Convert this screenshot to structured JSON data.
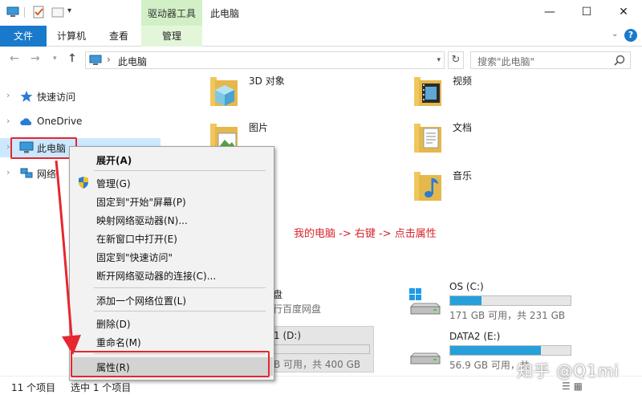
{
  "window": {
    "title": "此电脑",
    "contextual_tab_group": "驱动器工具",
    "controls": {
      "minimize": "—",
      "maximize": "☐",
      "close": "✕"
    }
  },
  "quick_access_toolbar": {
    "dropdown": "▾"
  },
  "ribbon": {
    "tabs": {
      "file": "文件",
      "computer": "计算机",
      "view": "查看",
      "manage": "管理"
    },
    "collapse_toggle": "⌄",
    "help": "?"
  },
  "address": {
    "back": "←",
    "forward": "→",
    "history": "▾",
    "up": "↑",
    "separator": "›",
    "path": "此电脑",
    "dropdown": "▾",
    "refresh": "↻",
    "search_placeholder": "搜索\"此电脑\""
  },
  "nav_pane": {
    "items": [
      {
        "label": "快速访问",
        "icon": "star-icon",
        "chevron": "›"
      },
      {
        "label": "OneDrive",
        "icon": "cloud-icon",
        "chevron": "›"
      },
      {
        "label": "此电脑",
        "icon": "computer-icon",
        "chevron": "›"
      },
      {
        "label": "网络",
        "icon": "network-icon",
        "chevron": "›"
      }
    ]
  },
  "folders": [
    {
      "label": "3D 对象",
      "icon": "3d-objects-folder-icon"
    },
    {
      "label": "视频",
      "icon": "videos-folder-icon"
    },
    {
      "label": "图片",
      "icon": "pictures-folder-icon"
    },
    {
      "label": "文档",
      "icon": "documents-folder-icon"
    },
    {
      "label": "音乐",
      "icon": "music-folder-icon"
    }
  ],
  "annotation": "我的电脑 -> 右键 -> 点击属性",
  "drives": [
    {
      "name": "OS (C:)",
      "info": "171 GB 可用，共 231 GB",
      "used_fraction": 0.26
    },
    {
      "name": "DATA2 (E:)",
      "info": "56.9 GB 可用，共 ",
      "used_fraction": 0.75
    }
  ],
  "partial_items": {
    "baidu_title": "盘",
    "baidu_sub": "行百度网盘",
    "d_drive_name": "1 (D:)",
    "d_drive_info": "B 可用，共 400 GB"
  },
  "context_menu": {
    "items": [
      {
        "label": "展开(A)"
      },
      {
        "label": "管理(G)"
      },
      {
        "label": "固定到\"开始\"屏幕(P)"
      },
      {
        "label": "映射网络驱动器(N)..."
      },
      {
        "label": "在新窗口中打开(E)"
      },
      {
        "label": "固定到\"快速访问\""
      },
      {
        "label": "断开网络驱动器的连接(C)..."
      },
      {
        "label": "添加一个网络位置(L)"
      },
      {
        "label": "删除(D)"
      },
      {
        "label": "重命名(M)"
      },
      {
        "label": "属性(R)"
      }
    ]
  },
  "status_bar": {
    "count": "11 个项目",
    "selected": "选中 1 个项目",
    "view_toggle": "☰ ▦"
  },
  "watermark": "知乎 @Q1mi",
  "colors": {
    "accent": "#1979ca",
    "selection": "#cce8ff",
    "highlight_red": "#e5272f",
    "drive_bar": "#26a0da",
    "contextual_tab": "#d2f0c6"
  }
}
